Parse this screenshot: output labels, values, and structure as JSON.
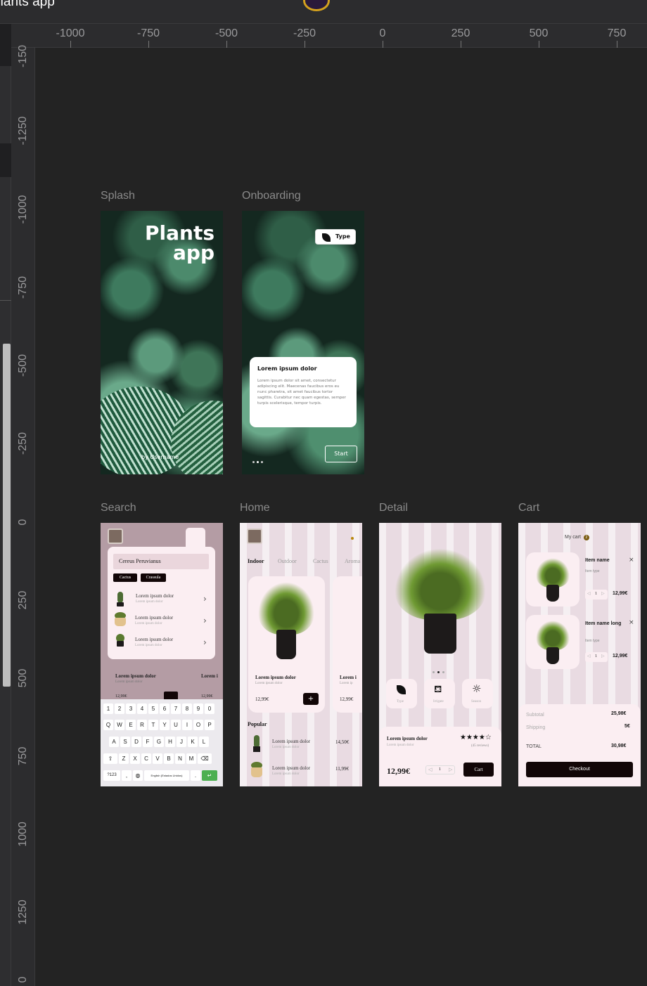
{
  "app": {
    "title": "Plants app"
  },
  "ruler": {
    "h": [
      "-1000",
      "-750",
      "-500",
      "-250",
      "0",
      "250",
      "500",
      "750"
    ],
    "v": [
      "-150",
      "-1250",
      "-1000",
      "-750",
      "-500",
      "-250",
      "0",
      "250",
      "500",
      "750",
      "1000",
      "1250",
      "0"
    ]
  },
  "frames": {
    "splash": {
      "label": "Splash",
      "title_line1": "Plants",
      "title_line2": "app",
      "byline": "by Username"
    },
    "onboarding": {
      "label": "Onboarding",
      "type_chip": "Type",
      "card_title": "Lorem ipsum dolor",
      "card_body": "Lorem ipsum dolor sit amet, consectetur adipiscing elit. Maecenas faucibus eros eu nunc pharetra, sit amet faucibus tortor sagittis. Curabitur nec quam egestas, semper turpis scelerisque, tempor turpis.",
      "start": "Start"
    },
    "search": {
      "label": "Search",
      "query": "Cereus Peruvianus",
      "chips": [
        "Cactus",
        "Crassula"
      ],
      "results": [
        {
          "title": "Lorem ipsum dolor",
          "sub": "Lorem ipsum dolor"
        },
        {
          "title": "Lorem ipsum dolor",
          "sub": "Lorem ipsum dolor"
        },
        {
          "title": "Lorem ipsum dolor",
          "sub": "Lorem ipsum dolor"
        }
      ],
      "bg_card_title": "Lorem ipsum dolor",
      "bg_card_sub": "Lorem ipsum dolor",
      "bg_card_price": "12,99€",
      "bg_card2_title": "Lorem i",
      "bg_card2_price": "12,99€",
      "keyboard": {
        "row1": [
          "1",
          "2",
          "3",
          "4",
          "5",
          "6",
          "7",
          "8",
          "9",
          "0"
        ],
        "row2": [
          "Q",
          "W",
          "E",
          "R",
          "T",
          "Y",
          "U",
          "I",
          "O",
          "P"
        ],
        "row3": [
          "A",
          "S",
          "D",
          "F",
          "G",
          "H",
          "J",
          "K",
          "L"
        ],
        "row4": [
          "⇧",
          "Z",
          "X",
          "C",
          "V",
          "B",
          "N",
          "M",
          "⌫"
        ],
        "sym": "?123",
        "comma": ",",
        "space": "English (Estados Unidos)",
        "period": ".",
        "enter": "↵"
      }
    },
    "home": {
      "label": "Home",
      "tabs": [
        "Indoor",
        "Outdoor",
        "Cactus",
        "Aroma"
      ],
      "card1": {
        "title": "Lorem ipsum dolor",
        "sub": "Lorem ipsum dolor",
        "price": "12,99€",
        "add": "+"
      },
      "card2": {
        "title": "Lorem i",
        "sub": "Lorem ip",
        "price": "12,99€"
      },
      "popular": "Popular",
      "list": [
        {
          "title": "Lorem ipsum dolor",
          "sub": "Lorem ipsum dolor",
          "price": "14,50€"
        },
        {
          "title": "Lorem ipsum dolor",
          "sub": "Lorem ipsum dolor",
          "price": "11,99€"
        }
      ]
    },
    "detail": {
      "label": "Detail",
      "features": [
        {
          "icon": "leaf-icon",
          "label": "Type"
        },
        {
          "icon": "watering-can-icon",
          "label": "Irrigate"
        },
        {
          "icon": "sun-icon",
          "label": "Season"
        }
      ],
      "title": "Lorem ipsum dolor",
      "sub": "Lorem ipsum dolor",
      "stars": "★★★★☆",
      "reviews": "(45 reviews)",
      "price": "12,99€",
      "qty": "1",
      "cart": "Cart"
    },
    "cart": {
      "label": "Cart",
      "title": "My cart",
      "badge": "2",
      "items": [
        {
          "name": "Item name",
          "type": "Item type",
          "qty": "1",
          "price": "12,99€"
        },
        {
          "name": "Item name long",
          "type": "Item type",
          "qty": "1",
          "price": "12,99€"
        }
      ],
      "subtotal_label": "Subtotal",
      "subtotal": "25,98€",
      "shipping_label": "Shipping",
      "shipping": "5€",
      "total_label": "TOTAL",
      "total": "30,98€",
      "checkout": "Checkout"
    }
  }
}
